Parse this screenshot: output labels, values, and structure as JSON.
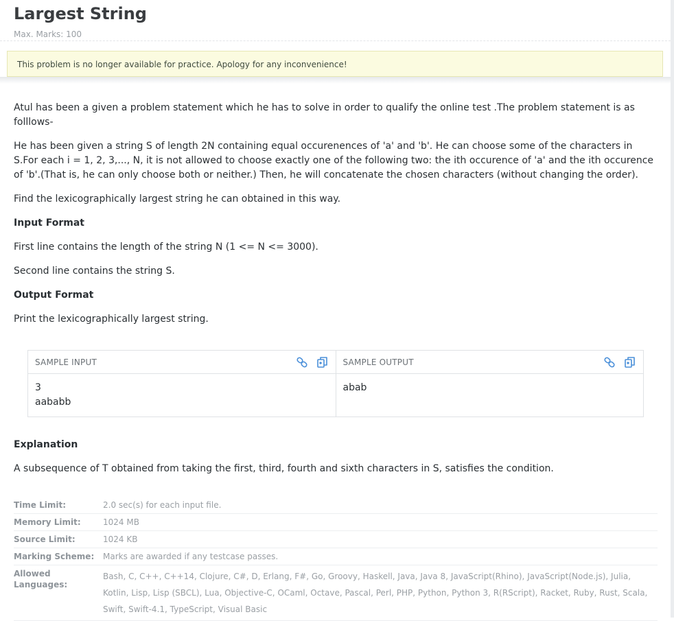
{
  "header": {
    "title": "Largest String",
    "marks": "Max. Marks: 100"
  },
  "alert": {
    "text": "This problem is no longer available for practice. Apology for any inconvenience!"
  },
  "statement": {
    "p1": "Atul has been a given a problem statement which he has to solve in order to qualify the online test .The problem statement is as folllows-",
    "p2": "He has been given a string S of length 2N containing equal occurenences of 'a' and 'b'. He can choose some of the characters in S.For each i = 1, 2, 3,..., N, it is not allowed to choose exactly one of the following two: the ith occurence of 'a' and the ith occurence of 'b'.(That is, he can only choose both or neither.) Then, he will concatenate the chosen characters (without changing the order).",
    "p3": "Find the lexicographically largest string he can obtained in this way.",
    "input_heading": "Input Format",
    "input_line1": "First line contains the length of the string N (1 <= N <= 3000).",
    "input_line2": "Second line contains the string S.",
    "output_heading": "Output Format",
    "output_line": "Print the lexicographically largest string."
  },
  "sample": {
    "input_label": "SAMPLE INPUT",
    "input_value": "3\naababb",
    "output_label": "SAMPLE OUTPUT",
    "output_value": "abab",
    "accent_color": "#4a8fd9"
  },
  "explanation": {
    "heading": "Explanation",
    "text": "A subsequence of T obtained from taking the first, third, fourth and sixth characters in S, satisfies the condition."
  },
  "limits": {
    "time_label": "Time Limit:",
    "time_value": "2.0 sec(s) for each input file.",
    "memory_label": "Memory Limit:",
    "memory_value": "1024 MB",
    "source_label": "Source Limit:",
    "source_value": "1024 KB",
    "marking_label": "Marking Scheme:",
    "marking_value": "Marks are awarded if any testcase passes.",
    "languages_label": "Allowed Languages:",
    "languages_value": "Bash, C, C++, C++14, Clojure, C#, D, Erlang, F#, Go, Groovy, Haskell, Java, Java 8, JavaScript(Rhino), JavaScript(Node.js), Julia, Kotlin, Lisp, Lisp (SBCL), Lua, Objective-C, OCaml, Octave, Pascal, Perl, PHP, Python, Python 3, R(RScript), Racket, Ruby, Rust, Scala, Swift, Swift-4.1, TypeScript, Visual Basic"
  }
}
